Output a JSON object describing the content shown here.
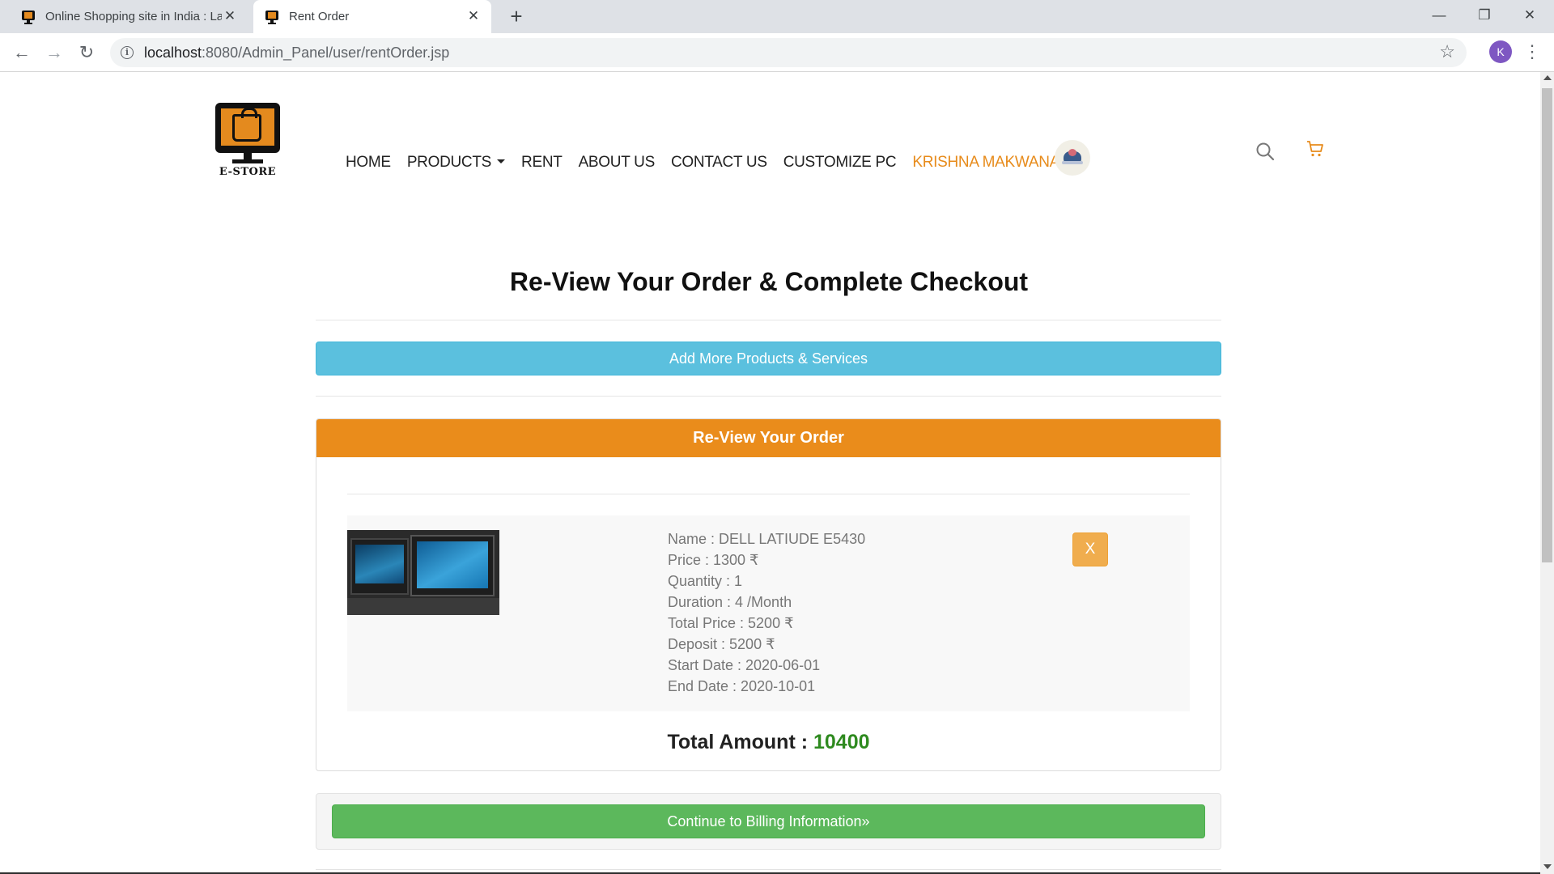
{
  "browser": {
    "tabs": [
      {
        "title": "Online Shopping site in India : La",
        "active": false
      },
      {
        "title": "Rent Order",
        "active": true
      }
    ],
    "new_tab": "+",
    "close_glyph": "✕",
    "url_host": "localhost",
    "url_rest": ":8080/Admin_Panel/user/rentOrder.jsp",
    "profile_initial": "K",
    "window_controls": {
      "minimize": "—",
      "restore": "❐",
      "close": "✕"
    },
    "nav": {
      "back": "←",
      "forward": "→",
      "reload": "↻",
      "info": "i",
      "star": "☆",
      "menu": "⋮"
    }
  },
  "site": {
    "brand": "E-STORE",
    "nav": {
      "home": "HOME",
      "products": "PRODUCTS",
      "rent": "RENT",
      "about": "ABOUT US",
      "contact": "CONTACT US",
      "customize": "CUSTOMIZE PC",
      "user": "KRISHNA MAKWANA"
    }
  },
  "page": {
    "title": "Re-View Your Order & Complete Checkout",
    "add_more_label": "Add More Products & Services",
    "panel_title": "Re-View Your Order",
    "item": {
      "name": "Name : DELL LATIUDE E5430",
      "price": "Price : 1300 ₹",
      "quantity": "Quantity : 1",
      "duration": "Duration : 4 /Month",
      "total_price": "Total Price : 5200 ₹",
      "deposit": "Deposit : 5200 ₹",
      "start_date": "Start Date : 2020-06-01",
      "end_date": "End Date : 2020-10-01",
      "remove_label": "X"
    },
    "total_label": "Total Amount : ",
    "total_value": "10400",
    "continue_label": "Continue to Billing Information»"
  },
  "colors": {
    "accent_orange": "#ea8c1b",
    "info_blue": "#5bc0de",
    "success_green": "#5cb85c",
    "warning_orange": "#f0ad4e",
    "total_green": "#2e8a1f"
  }
}
